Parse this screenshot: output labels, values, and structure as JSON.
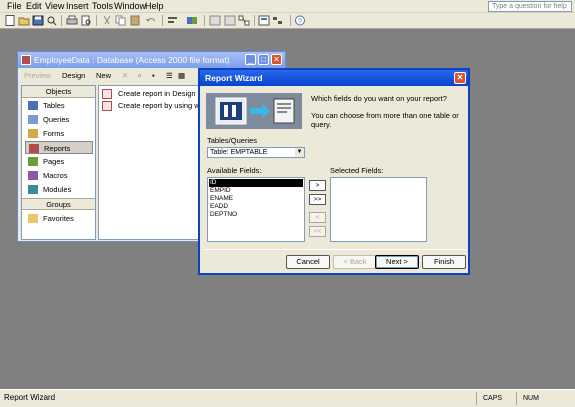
{
  "menubar": {
    "items": [
      "File",
      "Edit",
      "View",
      "Insert",
      "Tools",
      "Window",
      "Help"
    ],
    "help_box": "Type a question for help"
  },
  "db_window": {
    "title": "EmployeeData : Database (Access 2000 file format)",
    "toolbar": {
      "preview": "Preview",
      "design": "Design",
      "new": "New"
    },
    "nav_sections": {
      "objects": "Objects",
      "groups": "Groups"
    },
    "nav_items": [
      "Tables",
      "Queries",
      "Forms",
      "Reports",
      "Pages",
      "Macros",
      "Modules"
    ],
    "selected_nav": "Reports",
    "group_items": [
      "Favorites"
    ],
    "list_items": [
      "Create report in Design view",
      "Create report by using wizard"
    ]
  },
  "wizard": {
    "title": "Report Wizard",
    "question": "Which fields do you want on your report?",
    "hint": "You can choose from more than one table or query.",
    "tables_label": "Tables/Queries",
    "table_value": "Table: EMPTABLE",
    "available_label": "Available Fields:",
    "selected_label": "Selected Fields:",
    "available_fields": [
      "ID",
      "EMPID",
      "ENAME",
      "EADD",
      "DEPTNO"
    ],
    "selected_field": "ID",
    "move_buttons": [
      ">",
      ">>",
      "<",
      "<<"
    ],
    "buttons": {
      "cancel": "Cancel",
      "back": "< Back",
      "next": "Next >",
      "finish": "Finish"
    }
  },
  "statusbar": {
    "text": "Report Wizard",
    "caps": "CAPS",
    "num": "NUM"
  }
}
